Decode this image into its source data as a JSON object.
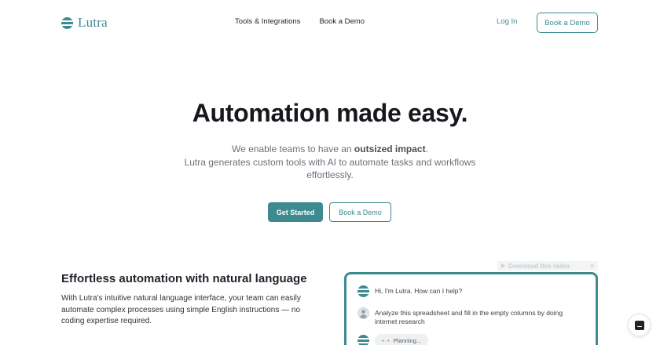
{
  "nav": {
    "logo_text": "Lutra",
    "links": [
      "Tools & Integrations",
      "Book a Demo"
    ],
    "login_label": "Log In",
    "demo_button_label": "Book a Demo"
  },
  "hero": {
    "title": "Automation made easy.",
    "sub_line1_prefix": "We enable teams to have an ",
    "sub_line1_bold": "outsized impact",
    "sub_line1_suffix": ".",
    "sub_line2": "Lutra generates custom tools with AI to automate tasks and workflows effortlessly.",
    "primary_cta": "Get Started",
    "secondary_cta": "Book a Demo"
  },
  "feature": {
    "title": "Effortless automation with natural language",
    "text": "With Lutra's intuitive natural language interface, your team can easily automate complex processes using simple English instructions — no coding expertise required."
  },
  "video": {
    "download_label": "Download this video",
    "close_glyph": "✕"
  },
  "chat": {
    "messages": [
      {
        "sender": "lutra",
        "text": "Hi, I'm Lutra. How can I help?"
      },
      {
        "sender": "user",
        "text": "Analyze this spreadsheet and fill in the empty columns by doing internet research"
      },
      {
        "sender": "lutra",
        "status": "Planning..."
      }
    ]
  },
  "colors": {
    "brand": "#3d8a90",
    "text": "#1f2329",
    "muted": "#6b7178"
  },
  "icons": {
    "logo": "lutra-logo-icon",
    "user_avatar": "user-avatar-icon",
    "chat_launcher": "chat-icon",
    "video_play": "play-icon",
    "video_close": "close-icon"
  }
}
